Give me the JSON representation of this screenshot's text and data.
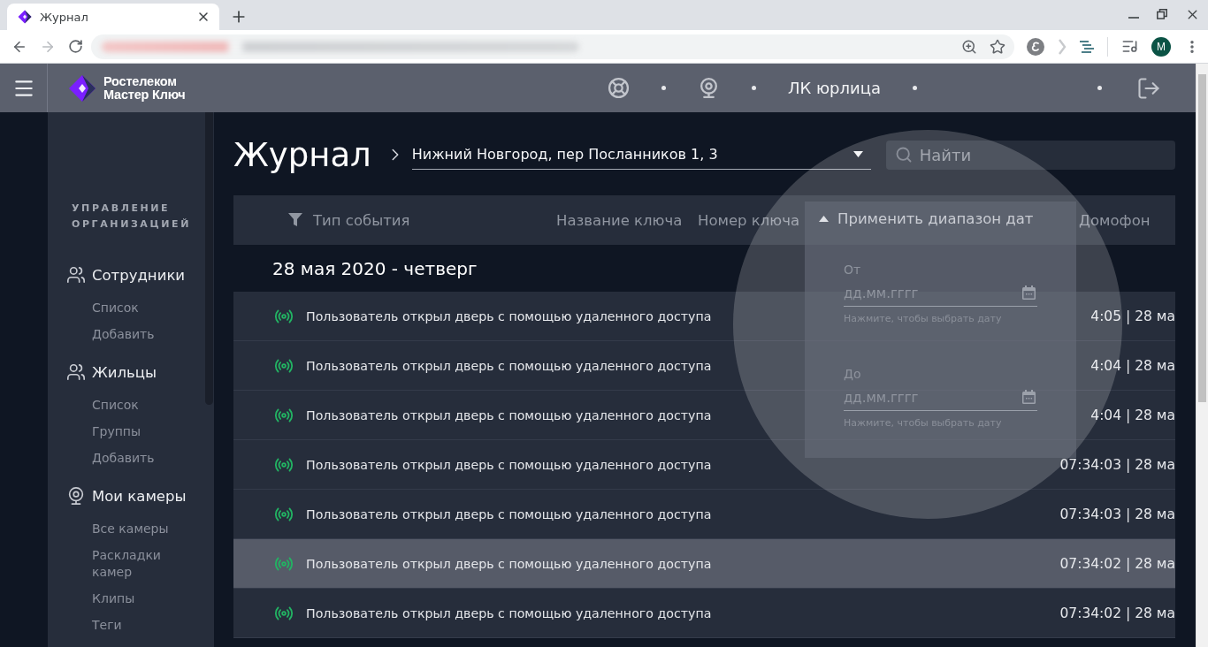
{
  "browser": {
    "tabs": [
      {
        "title": "Журнал",
        "selected": true
      }
    ],
    "back_disabled": false,
    "forward_disabled": true,
    "profile_initial": "M"
  },
  "header": {
    "logo_lines": [
      "Ростелеком",
      "Мастер Ключ"
    ],
    "account": "ЛК юрлица"
  },
  "sidebar": {
    "heading": "УПРАВЛЕНИЕ ОРГАНИЗАЦИЕЙ",
    "sections": [
      {
        "kind": "people",
        "title": "Сотрудники",
        "items": [
          "Список",
          "Добавить"
        ]
      },
      {
        "kind": "people",
        "title": "Жильцы",
        "items": [
          "Список",
          "Группы",
          "Добавить"
        ]
      },
      {
        "kind": "camera",
        "title": "Мои камеры",
        "items": [
          "Все камеры",
          "Раскладки камер",
          "Клипы",
          "Теги"
        ]
      }
    ]
  },
  "page": {
    "title": "Журнал",
    "address": "Нижний Новгород, пер Посланников 1, 3",
    "search": {
      "placeholder": "Найти"
    }
  },
  "table": {
    "columns": [
      {
        "label": "Тип события",
        "filter": true
      },
      {
        "label": "Название ключа",
        "filter": false
      },
      {
        "label": "Номер ключа",
        "filter": false
      },
      {
        "label": "Домофон",
        "filter": false
      }
    ],
    "groups": [
      {
        "date": "28 мая 2020 - четверг",
        "rows": [
          {
            "event": "Пользователь открыл дверь с помощью удаленного доступа",
            "time": "4:05 | 28 ма",
            "selected": false
          },
          {
            "event": "Пользователь открыл дверь с помощью удаленного доступа",
            "time": "4:04 | 28 ма",
            "selected": false
          },
          {
            "event": "Пользователь открыл дверь с помощью удаленного доступа",
            "time": "4:04 | 28 ма",
            "selected": false
          },
          {
            "event": "Пользователь открыл дверь с помощью удаленного доступа",
            "time": "07:34:03 | 28 ма",
            "selected": false
          },
          {
            "event": "Пользователь открыл дверь с помощью удаленного доступа",
            "time": "07:34:03 | 28 ма",
            "selected": false
          },
          {
            "event": "Пользователь открыл дверь с помощью удаленного доступа",
            "time": "07:34:02 | 28 ма",
            "selected": true
          },
          {
            "event": "Пользователь открыл дверь с помощью удаленного доступа",
            "time": "07:34:02 | 28 ма",
            "selected": false
          }
        ]
      }
    ]
  },
  "date_filter": {
    "title": "Применить диапазон дат",
    "expanded": true,
    "fields": [
      {
        "label": "От",
        "placeholder": "дд.мм.гггг",
        "hint": "Нажмите, чтобы выбрать дату"
      },
      {
        "label": "До",
        "placeholder": "дд.мм.гггг",
        "hint": "Нажмите, чтобы выбрать дату"
      }
    ]
  }
}
